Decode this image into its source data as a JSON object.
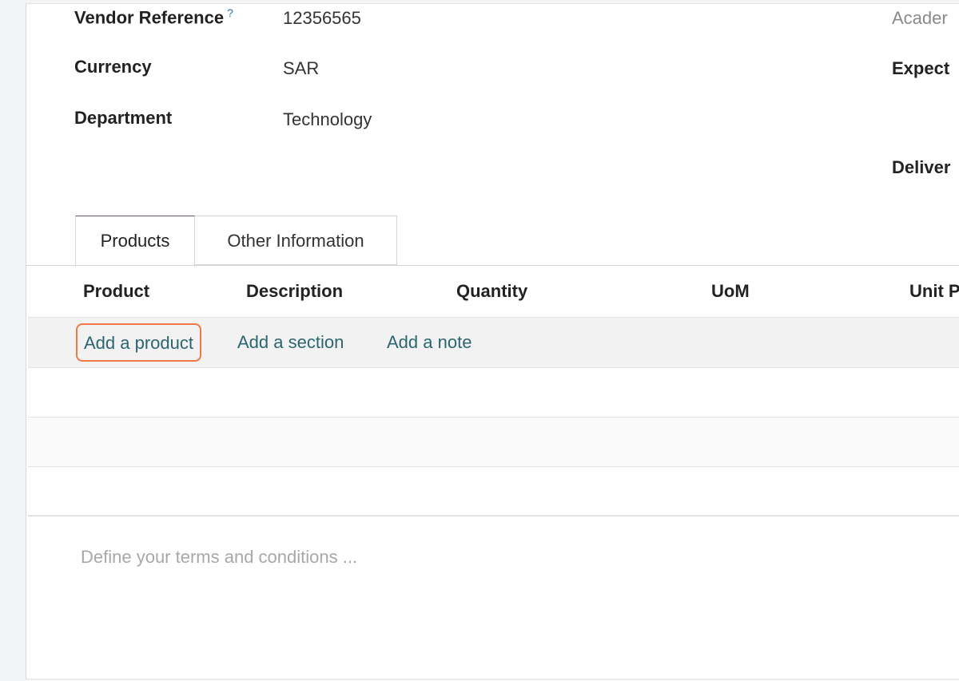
{
  "fields": {
    "vendor_reference": {
      "label": "Vendor Reference",
      "help": "?",
      "value": "12356565"
    },
    "currency": {
      "label": "Currency",
      "value": "SAR"
    },
    "department": {
      "label": "Department",
      "value": "Technology"
    }
  },
  "right_column": {
    "academic_label": "Acader",
    "expected_label": "Expect",
    "deliver_label": "Deliver"
  },
  "tabs": [
    {
      "label": "Products",
      "active": true
    },
    {
      "label": "Other Information",
      "active": false
    }
  ],
  "table": {
    "columns": [
      "Product",
      "Description",
      "Quantity",
      "UoM",
      "Unit P"
    ],
    "actions": {
      "add_product": "Add a product",
      "add_section": "Add a section",
      "add_note": "Add a note"
    }
  },
  "terms_placeholder": "Define your terms and conditions ...",
  "colors": {
    "link": "#2b6670",
    "highlight": "#f07746",
    "active_tab_accent": "#6b4a63"
  }
}
